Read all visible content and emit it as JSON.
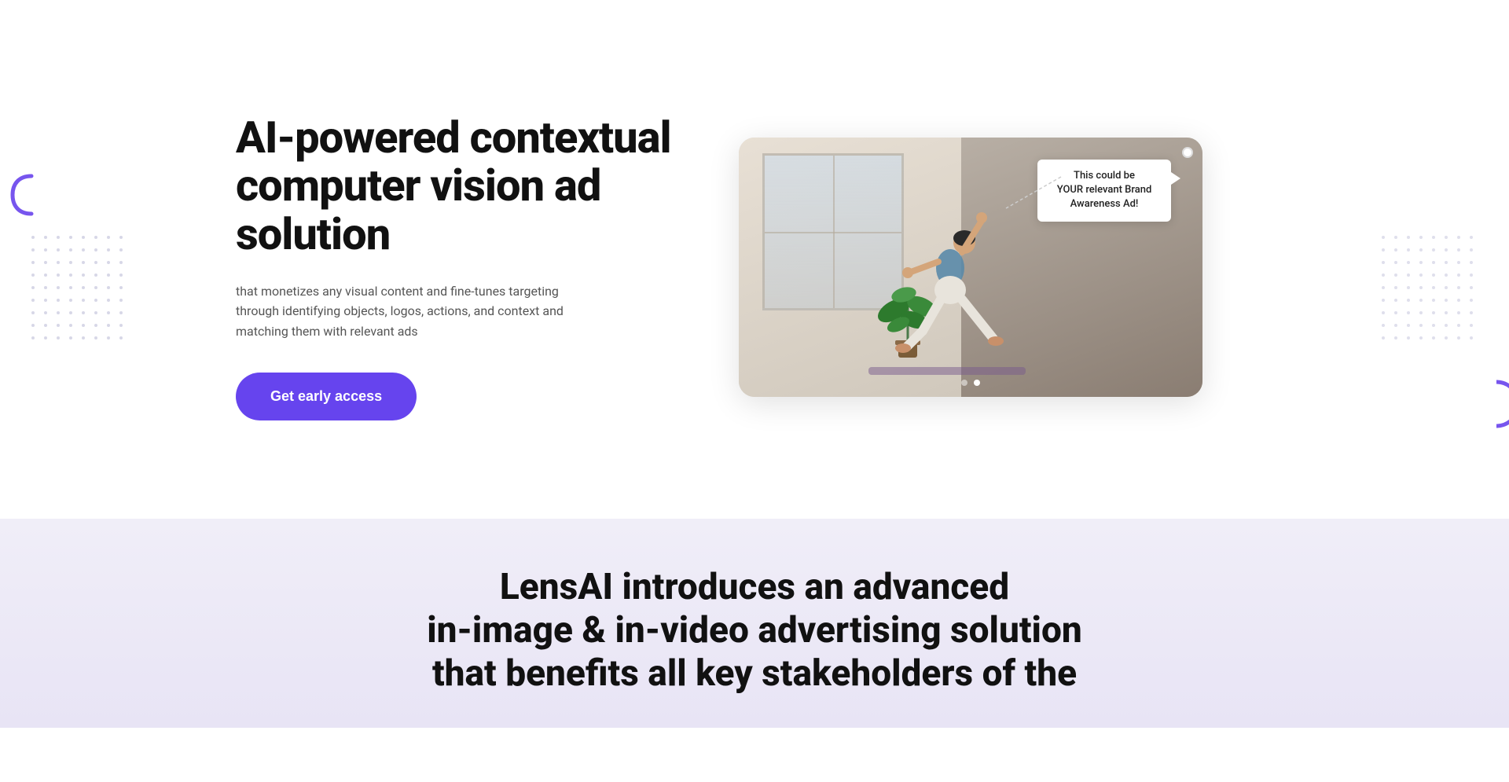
{
  "hero": {
    "title": "AI-powered contextual computer vision ad solution",
    "subtitle": "that monetizes any visual content and fine-tunes targeting through identifying objects, logos, actions, and context and matching them with relevant ads",
    "cta_label": "Get early access",
    "ad_tooltip_line1": "This could be",
    "ad_tooltip_line2": "YOUR relevant Brand",
    "ad_tooltip_line3": "Awareness Ad!"
  },
  "bottom": {
    "line1": "LensAI introduces an advanced",
    "line2": "in-image & in-video advertising solution",
    "line3": "that benefits all key stakeholders of the"
  },
  "decorations": {
    "bracket_icon": "❮",
    "circle_icon": "◐"
  },
  "carousel": {
    "dots": [
      "inactive",
      "active"
    ]
  }
}
